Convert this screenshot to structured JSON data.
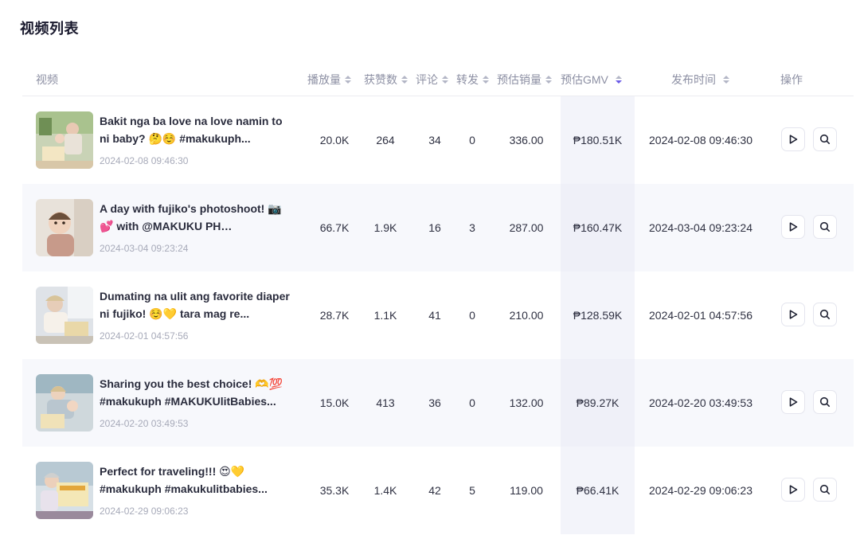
{
  "page": {
    "title": "视频列表"
  },
  "table": {
    "headers": {
      "video": "视频",
      "views": "播放量",
      "likes": "获赞数",
      "comments": "评论",
      "shares": "转发",
      "est_sales": "预估销量",
      "est_gmv": "预估GMV",
      "publish_time": "发布时间",
      "actions": "操作"
    },
    "rows": [
      {
        "title": "Bakit nga ba love na love namin to ni baby? 🤔☺️ #makukuph...",
        "date": "2024-02-08 09:46:30",
        "views": "20.0K",
        "likes": "264",
        "comments": "34",
        "shares": "0",
        "est_sales": "336.00",
        "est_gmv": "₱180.51K",
        "publish_time": "2024-02-08 09:46:30"
      },
      {
        "title": "A day with fujiko's photoshoot! 📷💕 with @MAKUKU PH #makukuph...",
        "date": "2024-03-04 09:23:24",
        "views": "66.7K",
        "likes": "1.9K",
        "comments": "16",
        "shares": "3",
        "est_sales": "287.00",
        "est_gmv": "₱160.47K",
        "publish_time": "2024-03-04 09:23:24"
      },
      {
        "title": "Dumating na ulit ang favorite diaper ni fujiko! ☺️💛 tara mag re...",
        "date": "2024-02-01 04:57:56",
        "views": "28.7K",
        "likes": "1.1K",
        "comments": "41",
        "shares": "0",
        "est_sales": "210.00",
        "est_gmv": "₱128.59K",
        "publish_time": "2024-02-01 04:57:56"
      },
      {
        "title": "Sharing you the best choice! 🫶💯 #makukuph #MAKUKUlitBabies...",
        "date": "2024-02-20 03:49:53",
        "views": "15.0K",
        "likes": "413",
        "comments": "36",
        "shares": "0",
        "est_sales": "132.00",
        "est_gmv": "₱89.27K",
        "publish_time": "2024-02-20 03:49:53"
      },
      {
        "title": "Perfect for traveling!!! 😍💛 #makukuph #makukulitbabies...",
        "date": "2024-02-29 09:06:23",
        "views": "35.3K",
        "likes": "1.4K",
        "comments": "42",
        "shares": "5",
        "est_sales": "119.00",
        "est_gmv": "₱66.41K",
        "publish_time": "2024-02-29 09:06:23"
      }
    ]
  },
  "icons": {
    "play": "play-icon",
    "search": "search-icon",
    "sort": "sort-caret-icon"
  },
  "colors": {
    "accent": "#6c5ce7",
    "header_text": "#8c8fa3",
    "row_alt": "#f7f8fc"
  }
}
